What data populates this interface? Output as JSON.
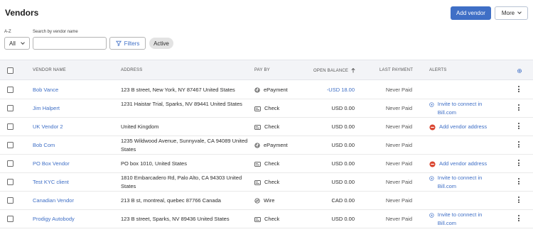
{
  "header": {
    "title": "Vendors",
    "add_vendor": "Add vendor",
    "more": "More"
  },
  "filters": {
    "az_label": "A-Z",
    "az_value": "All",
    "search_label": "Search by vendor name",
    "search_value": "",
    "filters_button": "Filters",
    "active_chip": "Active"
  },
  "table": {
    "columns": {
      "vendor_name": "VENDOR NAME",
      "address": "ADDRESS",
      "pay_by": "PAY BY",
      "open_balance": "OPEN BALANCE",
      "last_payment": "LAST PAYMENT",
      "alerts": "ALERTS"
    },
    "rows": [
      {
        "name": "Bob Vance",
        "address": "123 B street, New York, NY 87467 United States",
        "pay_by": "ePayment",
        "pay_icon": "epayment-icon",
        "balance": "-USD 18.00",
        "balance_negative": true,
        "last_payment": "Never Paid",
        "alert": "",
        "alert_type": ""
      },
      {
        "name": "Jim Halpert",
        "address": "1231 Haistar Trial, Sparks, NV 89441 United States",
        "pay_by": "Check",
        "pay_icon": "check-icon",
        "balance": "USD 0.00",
        "balance_negative": false,
        "last_payment": "Never Paid",
        "alert": "Invite to connect in Bill.com",
        "alert_type": "invite"
      },
      {
        "name": "UK Vendor 2",
        "address": "United Kingdom",
        "pay_by": "Check",
        "pay_icon": "check-icon",
        "balance": "USD 0.00",
        "balance_negative": false,
        "last_payment": "Never Paid",
        "alert": "Add vendor address",
        "alert_type": "error"
      },
      {
        "name": "Bob Com",
        "address": "1235 Wildwood Avenue, Sunnyvale, CA 94089 United States",
        "pay_by": "ePayment",
        "pay_icon": "epayment-icon",
        "balance": "USD 0.00",
        "balance_negative": false,
        "last_payment": "Never Paid",
        "alert": "",
        "alert_type": ""
      },
      {
        "name": "PO Box Vendor",
        "address": "PO box 1010, United States",
        "pay_by": "Check",
        "pay_icon": "check-icon",
        "balance": "USD 0.00",
        "balance_negative": false,
        "last_payment": "Never Paid",
        "alert": "Add vendor address",
        "alert_type": "error"
      },
      {
        "name": "Test KYC client",
        "address": "1810 Embarcadero Rd, Palo Alto, CA 94303 United States",
        "pay_by": "Check",
        "pay_icon": "check-icon",
        "balance": "USD 0.00",
        "balance_negative": false,
        "last_payment": "Never Paid",
        "alert": "Invite to connect in Bill.com",
        "alert_type": "invite"
      },
      {
        "name": "Canadian Vendor",
        "address": "213 B st, montreal, quebec 87766 Canada",
        "pay_by": "Wire",
        "pay_icon": "wire-icon",
        "balance": "CAD 0.00",
        "balance_negative": false,
        "last_payment": "Never Paid",
        "alert": "",
        "alert_type": ""
      },
      {
        "name": "Prodigy Autobody",
        "address": "123 B street, Sparks, NV 89436 United States",
        "pay_by": "Check",
        "pay_icon": "check-icon",
        "balance": "USD 0.00",
        "balance_negative": false,
        "last_payment": "Never Paid",
        "alert": "Invite to connect in Bill.com",
        "alert_type": "invite"
      }
    ]
  },
  "colors": {
    "accent": "#3f6fc6",
    "error": "#d9442f",
    "header_bg": "#f3f4f7"
  },
  "icons": {
    "sort": "arrow-up-icon",
    "settings": "gear-icon",
    "filter": "funnel-icon"
  }
}
